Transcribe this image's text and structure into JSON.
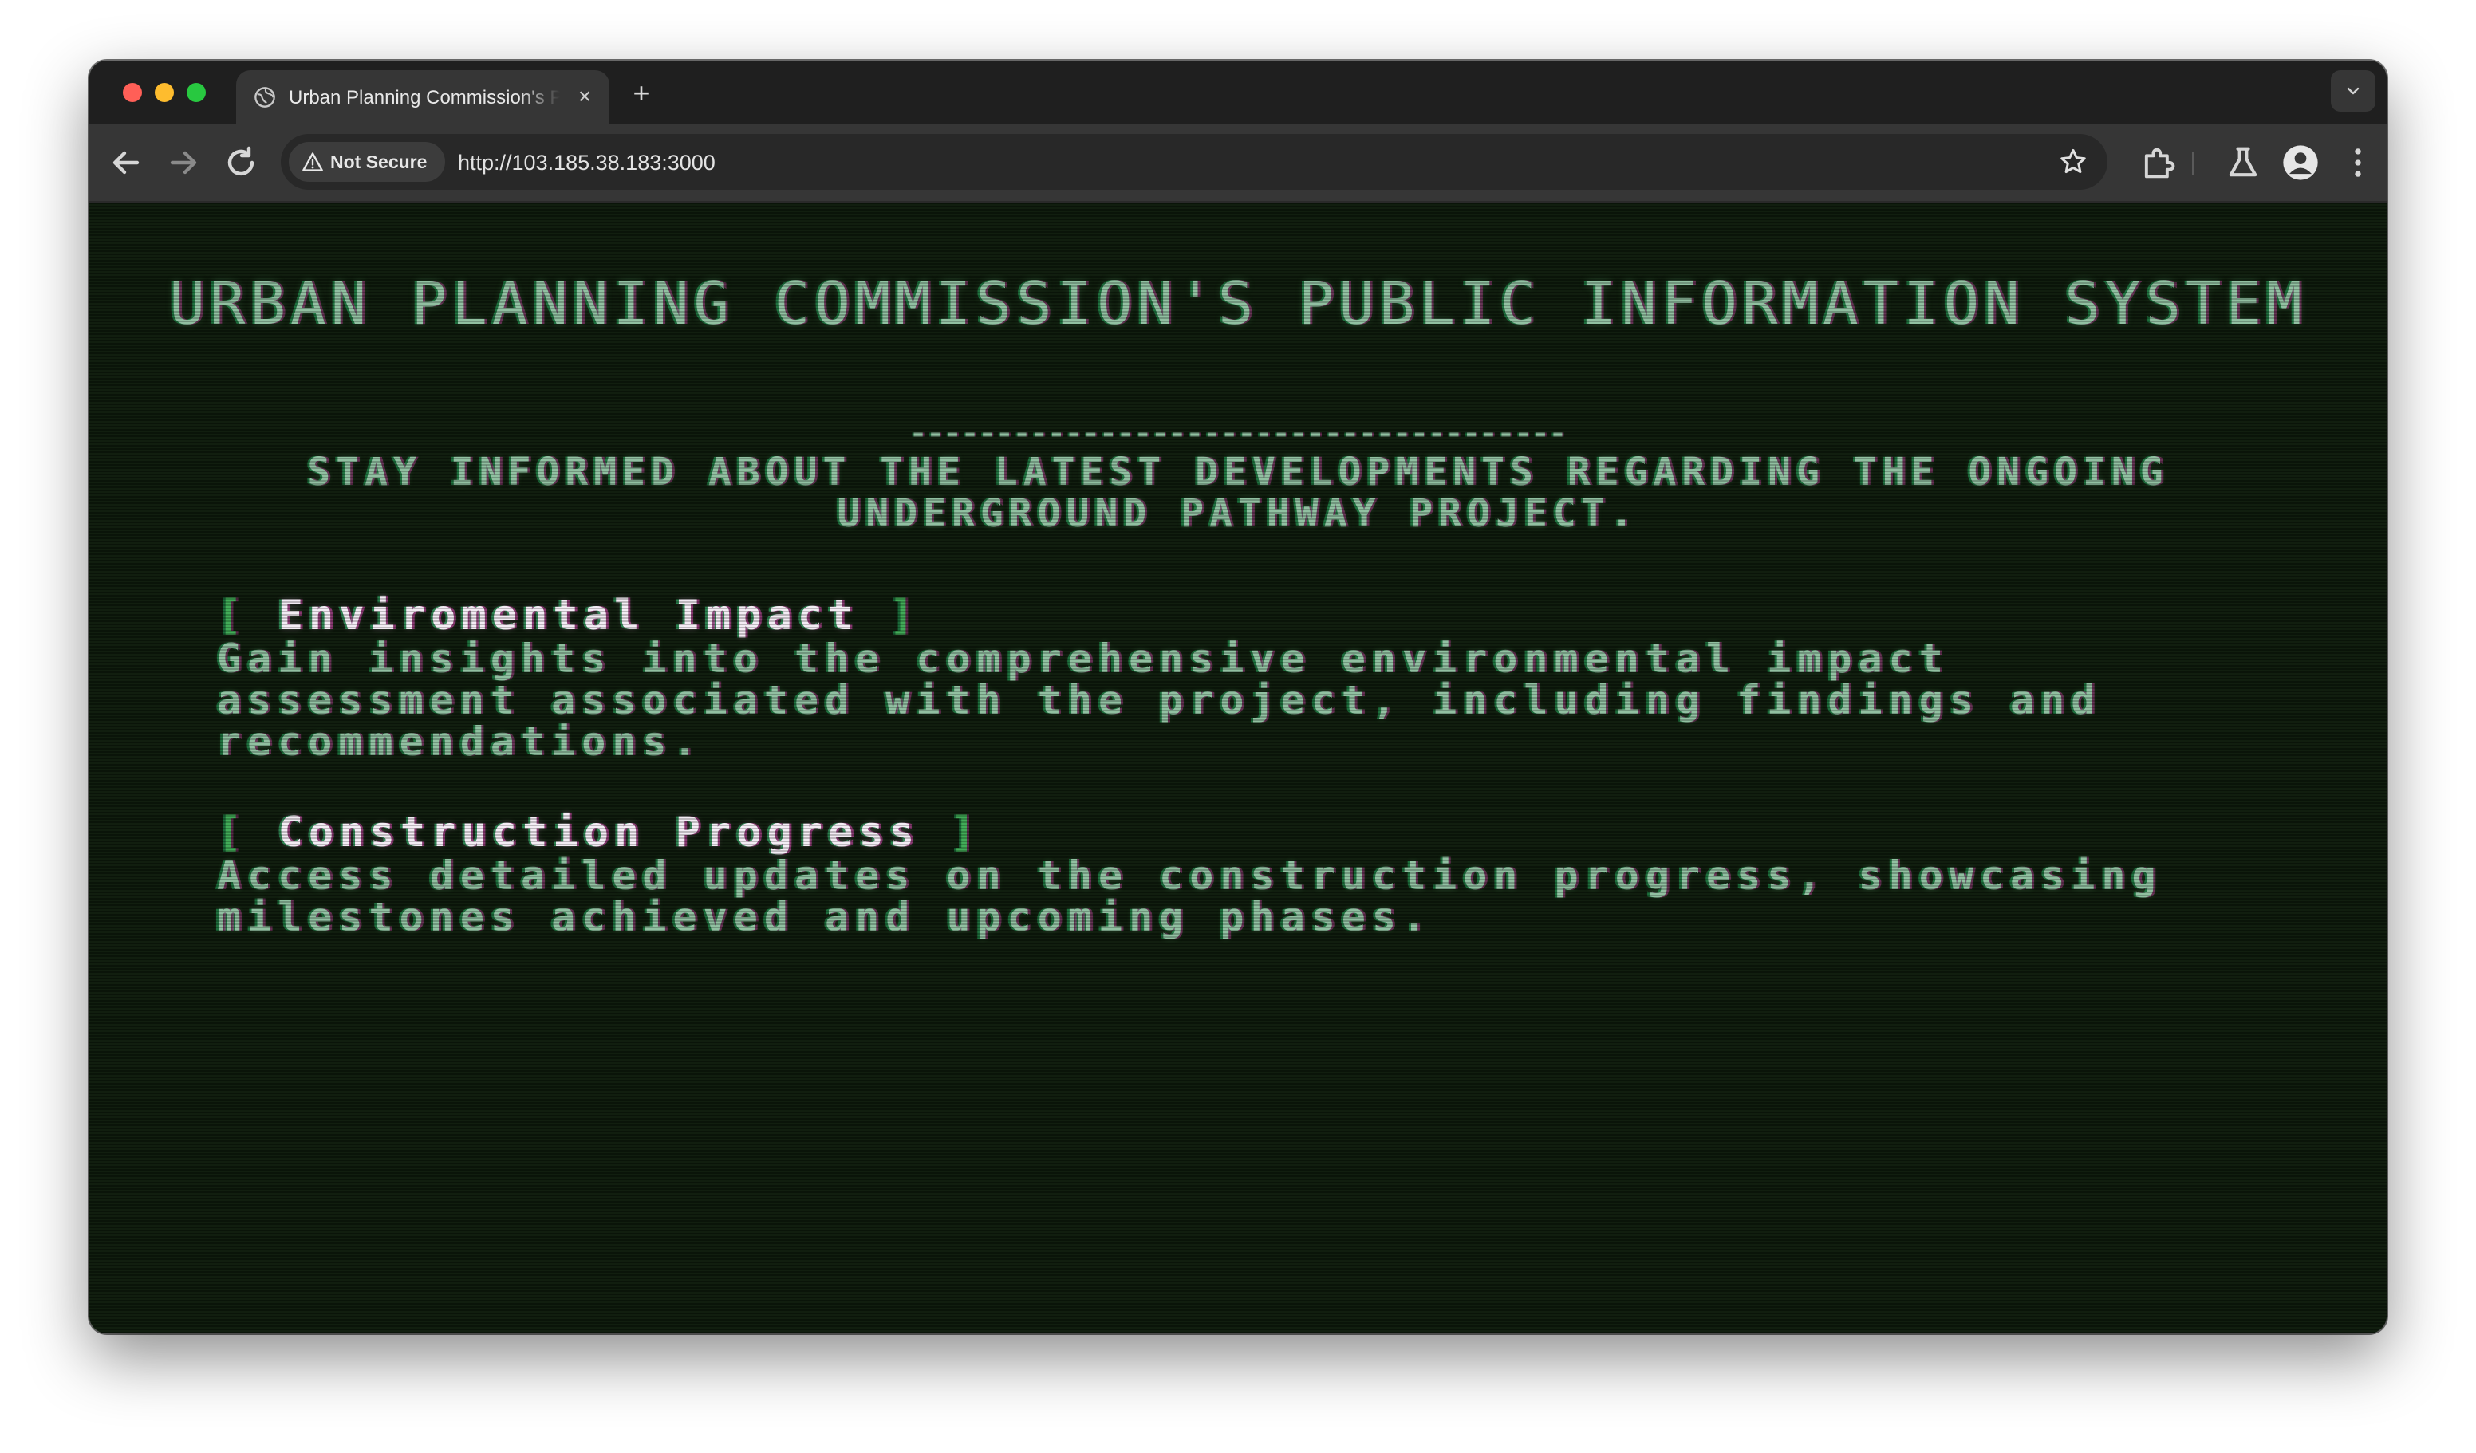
{
  "browser": {
    "tab": {
      "title": "Urban Planning Commission's Public Information System",
      "close_glyph": "×",
      "icon": "globe-icon"
    },
    "new_tab_glyph": "+",
    "security": {
      "label": "Not Secure",
      "icon": "warning-icon"
    },
    "url": "http://103.185.38.183:3000",
    "toolbar_icons": [
      "back-icon",
      "forward-icon",
      "reload-icon",
      "star-icon",
      "extensions-icon",
      "labs-icon",
      "profile-icon",
      "menu-icon"
    ]
  },
  "page": {
    "title": "URBAN PLANNING COMMISSION'S PUBLIC INFORMATION SYSTEM",
    "divider": "--------------------------------------",
    "subtitle": "STAY INFORMED ABOUT THE LATEST DEVELOPMENTS REGARDING THE ONGOING UNDERGROUND PATHWAY PROJECT.",
    "sections": [
      {
        "bracket_open": "[",
        "heading": "Enviromental Impact",
        "bracket_close": "]",
        "body": "Gain insights into the comprehensive environmental impact assessment associated with the project, including findings and recommendations."
      },
      {
        "bracket_open": "[",
        "heading": "Construction Progress",
        "bracket_close": "]",
        "body": "Access detailed updates on the construction progress, showcasing milestones achieved and upcoming phases."
      }
    ],
    "colors": {
      "background": "#0d1a0b",
      "text": "#8fbfa0",
      "bracket": "#3faa55",
      "heading": "#f3ecf4"
    }
  }
}
